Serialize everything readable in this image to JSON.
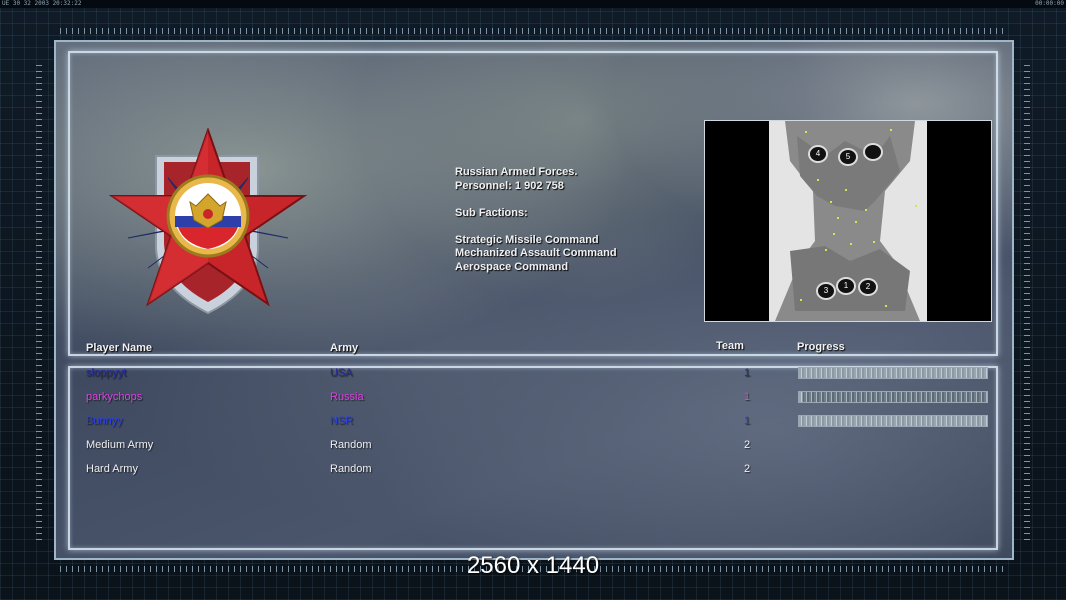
{
  "system_bar": {
    "left_text": "UE 30 32 2003 20:32:22",
    "right_text": "00:00:00"
  },
  "faction_info": {
    "lines": [
      "Russian Armed Forces.",
      "Personnel: 1 902 758",
      "",
      "Sub Factions:",
      "",
      "Strategic Missile Command",
      "Mechanized Assault Command",
      "Aerospace Command"
    ]
  },
  "headers": {
    "player_name": "Player Name",
    "army": "Army",
    "team": "Team",
    "progress": "Progress"
  },
  "players": [
    {
      "name": "sloppyyt",
      "army": "USA",
      "team": "1",
      "color": "#2a2a9a",
      "progress": 1.0
    },
    {
      "name": "parkychops",
      "army": "Russia",
      "team": "1",
      "color": "#e040e0",
      "progress": 0.02
    },
    {
      "name": "Bunnyy",
      "army": "NSR",
      "team": "1",
      "color": "#2a40e0",
      "progress": 1.0
    },
    {
      "name": "Medium Army",
      "army": "Random",
      "team": "2",
      "color": "#f0f0f0"
    },
    {
      "name": "Hard Army",
      "army": "Random",
      "team": "2",
      "color": "#f0f0f0"
    }
  ],
  "minimap": {
    "start_labels": [
      "4",
      "5",
      "",
      "3",
      "1",
      "2"
    ]
  },
  "resolution_label": "2560 x 1440",
  "colors": {
    "frame": "#9fb6c9",
    "panel_border": "#d7e4f0",
    "emblem_red": "#c8252a"
  }
}
